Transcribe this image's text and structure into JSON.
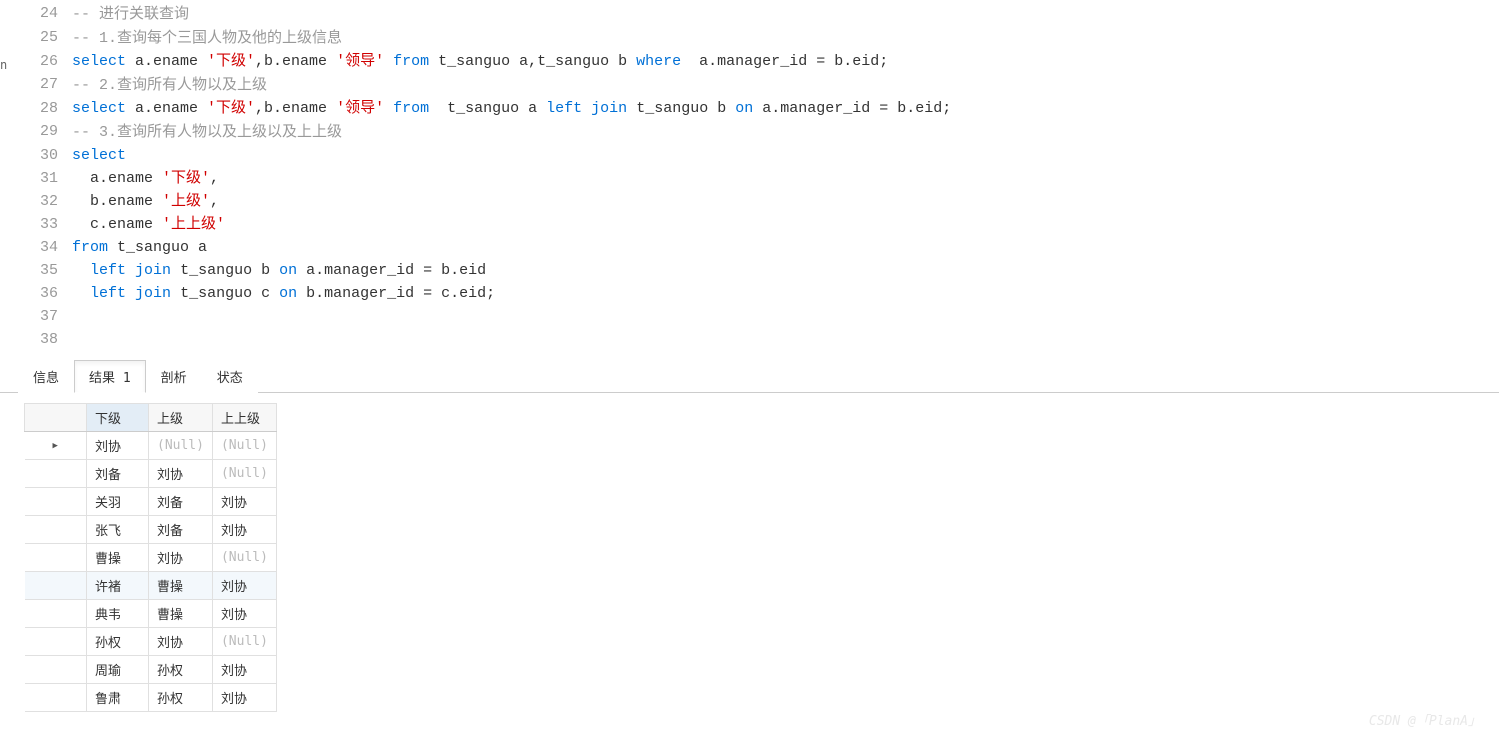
{
  "left_fragment": "n",
  "code": {
    "lines": [
      {
        "n": 24,
        "tokens": [
          {
            "t": "cmt",
            "v": "-- "
          },
          {
            "t": "cmt cjk-cmt",
            "v": "进行关联查询"
          }
        ]
      },
      {
        "n": 25,
        "tokens": [
          {
            "t": "cmt",
            "v": "-- 1."
          },
          {
            "t": "cmt cjk-cmt",
            "v": "查询每个三国人物及他的上级信息"
          }
        ]
      },
      {
        "n": 26,
        "tokens": [
          {
            "t": "kw",
            "v": "select"
          },
          {
            "t": "",
            "v": " a.ename "
          },
          {
            "t": "str",
            "v": "'下级'"
          },
          {
            "t": "",
            "v": ",b.ename "
          },
          {
            "t": "str",
            "v": "'领导'"
          },
          {
            "t": "",
            "v": " "
          },
          {
            "t": "kw",
            "v": "from"
          },
          {
            "t": "",
            "v": " t_sanguo a,t_sanguo b "
          },
          {
            "t": "kw",
            "v": "where"
          },
          {
            "t": "",
            "v": "  a.manager_id = b.eid;"
          }
        ]
      },
      {
        "n": 27,
        "tokens": [
          {
            "t": "cmt",
            "v": "-- 2."
          },
          {
            "t": "cmt cjk-cmt",
            "v": "查询所有人物以及上级"
          }
        ]
      },
      {
        "n": 28,
        "tokens": [
          {
            "t": "kw",
            "v": "select"
          },
          {
            "t": "",
            "v": " a.ename "
          },
          {
            "t": "str",
            "v": "'下级'"
          },
          {
            "t": "",
            "v": ",b.ename "
          },
          {
            "t": "str",
            "v": "'领导'"
          },
          {
            "t": "",
            "v": " "
          },
          {
            "t": "kw",
            "v": "from"
          },
          {
            "t": "",
            "v": "  t_sanguo a "
          },
          {
            "t": "kw",
            "v": "left"
          },
          {
            "t": "",
            "v": " "
          },
          {
            "t": "kw",
            "v": "join"
          },
          {
            "t": "",
            "v": " t_sanguo b "
          },
          {
            "t": "kw",
            "v": "on"
          },
          {
            "t": "",
            "v": " a.manager_id = b.eid;"
          }
        ]
      },
      {
        "n": 29,
        "tokens": [
          {
            "t": "cmt",
            "v": "-- 3."
          },
          {
            "t": "cmt cjk-cmt",
            "v": "查询所有人物以及上级以及上上级"
          }
        ]
      },
      {
        "n": 30,
        "tokens": [
          {
            "t": "kw",
            "v": "select"
          }
        ]
      },
      {
        "n": 31,
        "tokens": [
          {
            "t": "",
            "v": "  a.ename "
          },
          {
            "t": "str",
            "v": "'下级'"
          },
          {
            "t": "",
            "v": ","
          }
        ]
      },
      {
        "n": 32,
        "tokens": [
          {
            "t": "",
            "v": "  b.ename "
          },
          {
            "t": "str",
            "v": "'上级'"
          },
          {
            "t": "",
            "v": ","
          }
        ]
      },
      {
        "n": 33,
        "tokens": [
          {
            "t": "",
            "v": "  c.ename "
          },
          {
            "t": "str",
            "v": "'上上级'"
          }
        ]
      },
      {
        "n": 34,
        "tokens": [
          {
            "t": "kw",
            "v": "from"
          },
          {
            "t": "",
            "v": " t_sanguo a"
          }
        ]
      },
      {
        "n": 35,
        "tokens": [
          {
            "t": "",
            "v": "  "
          },
          {
            "t": "kw",
            "v": "left"
          },
          {
            "t": "",
            "v": " "
          },
          {
            "t": "kw",
            "v": "join"
          },
          {
            "t": "",
            "v": " t_sanguo b "
          },
          {
            "t": "kw",
            "v": "on"
          },
          {
            "t": "",
            "v": " a.manager_id = b.eid"
          }
        ]
      },
      {
        "n": 36,
        "tokens": [
          {
            "t": "",
            "v": "  "
          },
          {
            "t": "kw",
            "v": "left"
          },
          {
            "t": "",
            "v": " "
          },
          {
            "t": "kw",
            "v": "join"
          },
          {
            "t": "",
            "v": " t_sanguo c "
          },
          {
            "t": "kw",
            "v": "on"
          },
          {
            "t": "",
            "v": " b.manager_id = c.eid;"
          }
        ]
      },
      {
        "n": 37,
        "tokens": []
      },
      {
        "n": 38,
        "tokens": []
      }
    ]
  },
  "tabs": [
    {
      "label": "信息",
      "active": false
    },
    {
      "label": "结果 1",
      "active": true
    },
    {
      "label": "剖析",
      "active": false
    },
    {
      "label": "状态",
      "active": false
    }
  ],
  "results": {
    "headers": [
      "下级",
      "上级",
      "上上级"
    ],
    "selected_header_index": 0,
    "current_row_index": 0,
    "hover_row_index": 5,
    "rows": [
      [
        "刘协",
        null,
        null
      ],
      [
        "刘备",
        "刘协",
        null
      ],
      [
        "关羽",
        "刘备",
        "刘协"
      ],
      [
        "张飞",
        "刘备",
        "刘协"
      ],
      [
        "曹操",
        "刘协",
        null
      ],
      [
        "许褚",
        "曹操",
        "刘协"
      ],
      [
        "典韦",
        "曹操",
        "刘协"
      ],
      [
        "孙权",
        "刘协",
        null
      ],
      [
        "周瑜",
        "孙权",
        "刘协"
      ],
      [
        "鲁肃",
        "孙权",
        "刘协"
      ]
    ],
    "null_display": "(Null)"
  },
  "watermark": "CSDN @「PlanA」"
}
